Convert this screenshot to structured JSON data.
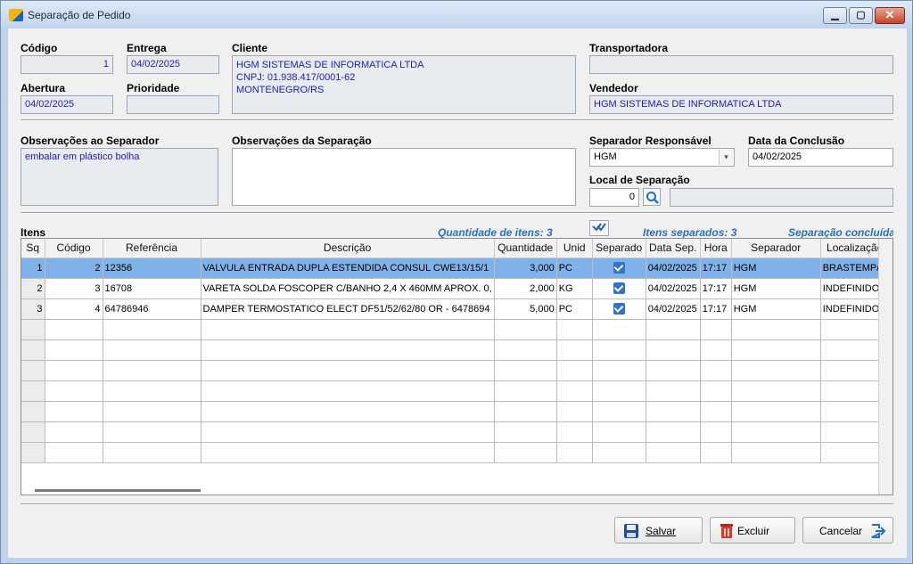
{
  "window": {
    "title": "Separação de Pedido",
    "min_glyph": "▁",
    "max_glyph": "▢",
    "close_glyph": "✕"
  },
  "header": {
    "codigo": {
      "label": "Código",
      "value": "1"
    },
    "entrega": {
      "label": "Entrega",
      "value": "04/02/2025"
    },
    "cliente": {
      "label": "Cliente",
      "value": "HGM SISTEMAS DE INFORMATICA LTDA\nCNPJ: 01.938.417/0001-62\nMONTENEGRO/RS"
    },
    "transportadora": {
      "label": "Transportadora",
      "value": ""
    },
    "abertura": {
      "label": "Abertura",
      "value": "04/02/2025"
    },
    "prioridade": {
      "label": "Prioridade",
      "value": ""
    },
    "vendedor": {
      "label": "Vendedor",
      "value": "HGM SISTEMAS DE INFORMATICA LTDA"
    }
  },
  "observacoes": {
    "separador": {
      "label": "Observações ao Separador",
      "value": "embalar em plástico bolha"
    },
    "separacao": {
      "label": "Observações da Separação",
      "value": ""
    }
  },
  "separador": {
    "label": "Separador Responsável",
    "value": "HGM",
    "arrow": "▾"
  },
  "conclusao": {
    "label": "Data da Conclusão",
    "value": "04/02/2025"
  },
  "local": {
    "label": "Local de Separação",
    "code": "0",
    "description": ""
  },
  "itens": {
    "label": "Itens",
    "quantidade_itens": "Quantidade de itens: 3",
    "itens_separados": "Itens separados: 3",
    "status": "Separação concluída",
    "columns": [
      "Sq",
      "Código",
      "Referência",
      "Descrição",
      "Quantidade",
      "Unid",
      "Separado",
      "Data Sep.",
      "Hora",
      "Separador",
      "Localização"
    ],
    "rows": [
      {
        "sq": "1",
        "codigo": "2",
        "referencia": "12356",
        "descricao": "VALVULA ENTRADA DUPLA ESTENDIDA CONSUL CWE13/15/1",
        "quantidade": "3,000",
        "unid": "PC",
        "separado": true,
        "data": "04/02/2025",
        "hora": "17:17",
        "separador": "HGM",
        "localizacao": "BRASTEMP/C"
      },
      {
        "sq": "2",
        "codigo": "3",
        "referencia": "16708",
        "descricao": "VARETA SOLDA FOSCOPER C/BANHO 2,4 X 460MM APROX. 0,",
        "quantidade": "2,000",
        "unid": "KG",
        "separado": true,
        "data": "04/02/2025",
        "hora": "17:17",
        "separador": "HGM",
        "localizacao": "INDEFINIDO"
      },
      {
        "sq": "3",
        "codigo": "4",
        "referencia": "64786946",
        "descricao": "DAMPER TERMOSTATICO ELECT DF51/52/62/80 OR - 6478694",
        "quantidade": "5,000",
        "unid": "PC",
        "separado": true,
        "data": "04/02/2025",
        "hora": "17:17",
        "separador": "HGM",
        "localizacao": "INDEFINIDO"
      }
    ]
  },
  "buttons": {
    "salvar": "Salvar",
    "excluir": "Excluir",
    "cancelar": "Cancelar"
  }
}
